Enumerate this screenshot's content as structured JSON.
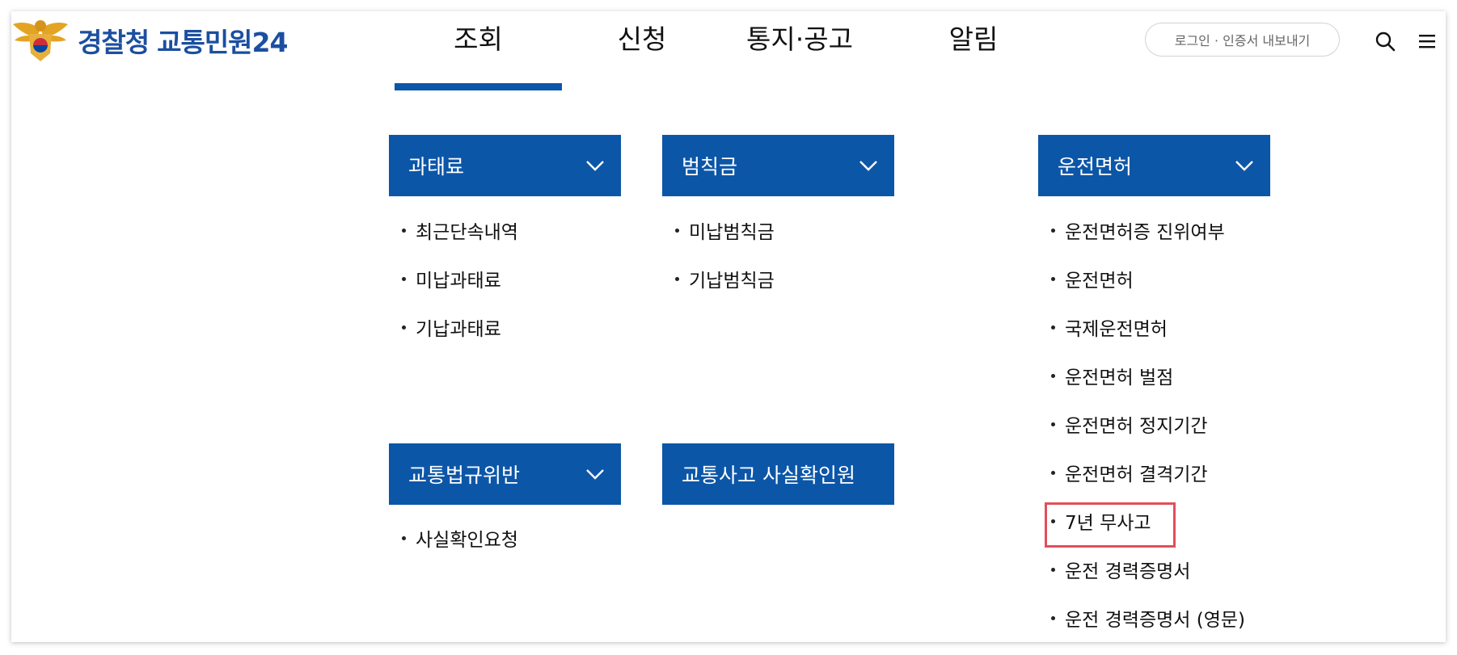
{
  "header": {
    "logo_text_agency": "경찰청",
    "logo_text_service": "교통민원24",
    "nav": [
      {
        "label": "조회",
        "active": true
      },
      {
        "label": "신청",
        "active": false
      },
      {
        "label": "통지·공고",
        "active": false
      },
      {
        "label": "알림",
        "active": false
      }
    ],
    "login_label": "로그인 · 인증서 내보내기"
  },
  "menu": {
    "fines": {
      "title": "과태료",
      "items": [
        "최근단속내역",
        "미납과태료",
        "기납과태료"
      ]
    },
    "penalties": {
      "title": "범칙금",
      "items": [
        "미납범칙금",
        "기납범칙금"
      ]
    },
    "license": {
      "title": "운전면허",
      "items": [
        "운전면허증 진위여부",
        "운전면허",
        "국제운전면허",
        "운전면허 벌점",
        "운전면허 정지기간",
        "운전면허 결격기간",
        "7년 무사고",
        "운전 경력증명서",
        "운전 경력증명서 (영문)"
      ]
    },
    "violation": {
      "title": "교통법규위반",
      "items": [
        "사실확인요청"
      ]
    },
    "accident": {
      "title": "교통사고 사실확인원"
    }
  },
  "colors": {
    "primary": "#0c56a8",
    "highlight": "#e24e5a",
    "logo_blue": "#1b4fa0"
  },
  "icons": {
    "emblem": "police-emblem-icon",
    "search": "search-icon",
    "menu": "hamburger-menu-icon",
    "expand": "chevron-down-icon"
  }
}
